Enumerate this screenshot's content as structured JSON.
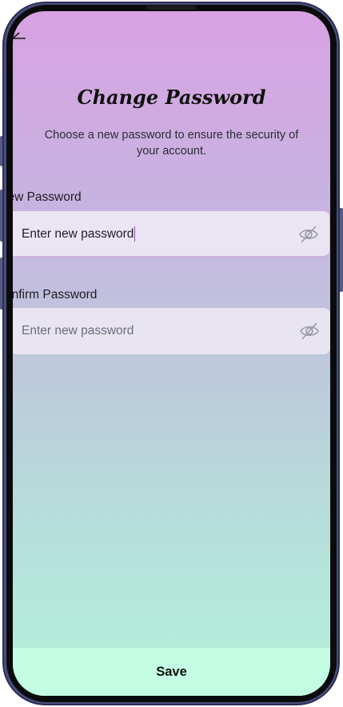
{
  "header": {
    "title": "Change Password",
    "subtitle": "Choose a new password to ensure the security of your account."
  },
  "fields": {
    "new_password": {
      "label": "New Password",
      "visible_label": "lew Password",
      "value": "Enter new password",
      "placeholder": "Enter new password",
      "icon": "eye-off-icon"
    },
    "confirm_password": {
      "label": "Confirm Password",
      "visible_label": "onfirm Password",
      "value": "",
      "placeholder": "Enter new password",
      "icon": "eye-off-icon"
    }
  },
  "footer": {
    "save_label": "Save"
  },
  "icons": {
    "back": "arrow-left-icon"
  },
  "colors": {
    "gradient_top": "#d8a2e3",
    "gradient_bottom": "#b2f1db",
    "input_bg": "#e8e4f1",
    "active_border": "#d5a7e4",
    "save_bar": "#c3fde3",
    "phone_frame": "#4a4f7e"
  }
}
